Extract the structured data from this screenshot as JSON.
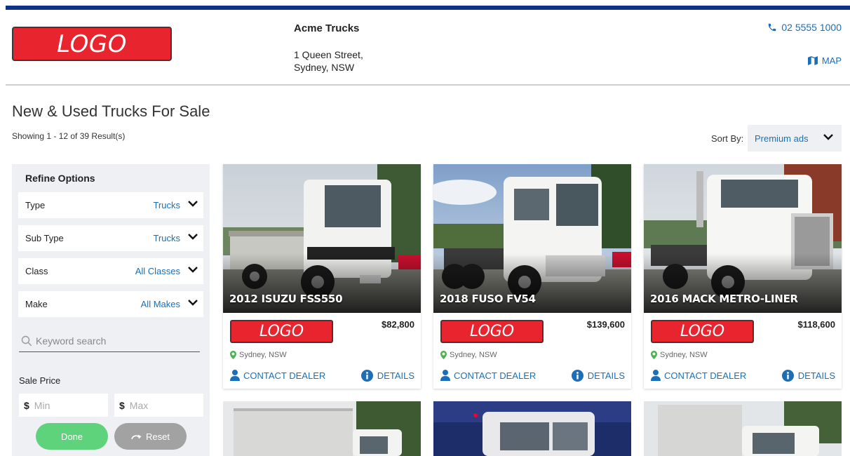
{
  "header": {
    "logo_text": "LOGO",
    "dealer_name": "Acme Trucks",
    "address_line1": "1 Queen Street,",
    "address_line2": "Sydney, NSW",
    "phone": "02 5555 1000",
    "map_label": "MAP"
  },
  "listing": {
    "title": "New & Used Trucks For Sale",
    "showing": "Showing 1 - 12 of 39 Result(s)",
    "sort_label": "Sort By:",
    "sort_value": "Premium ads"
  },
  "sidebar": {
    "title": "Refine Options",
    "filters": [
      {
        "label": "Type",
        "value": "Trucks"
      },
      {
        "label": "Sub Type",
        "value": "Trucks"
      },
      {
        "label": "Class",
        "value": "All Classes"
      },
      {
        "label": "Make",
        "value": "All Makes"
      }
    ],
    "keyword_placeholder": "Keyword search",
    "price_label": "Sale Price",
    "currency": "$",
    "min_placeholder": "Min",
    "max_placeholder": "Max",
    "done_label": "Done",
    "reset_label": "Reset"
  },
  "cards": [
    {
      "title": "2012 ISUZU FSS550",
      "logo": "LOGO",
      "price": "$82,800",
      "location": "Sydney, NSW",
      "contact": "CONTACT DEALER",
      "details": "DETAILS"
    },
    {
      "title": "2018 FUSO FV54",
      "logo": "LOGO",
      "price": "$139,600",
      "location": "Sydney, NSW",
      "contact": "CONTACT DEALER",
      "details": "DETAILS"
    },
    {
      "title": "2016 MACK METRO-LINER",
      "logo": "LOGO",
      "price": "$118,600",
      "location": "Sydney, NSW",
      "contact": "CONTACT DEALER",
      "details": "DETAILS"
    }
  ],
  "colors": {
    "brand_blue": "#10318a",
    "link_blue": "#1b6fb8",
    "logo_red": "#e8252f",
    "done_green": "#5fd37b",
    "reset_gray": "#a2a2a2",
    "panel_gray": "#eef0f4",
    "location_green": "#4caf50"
  }
}
